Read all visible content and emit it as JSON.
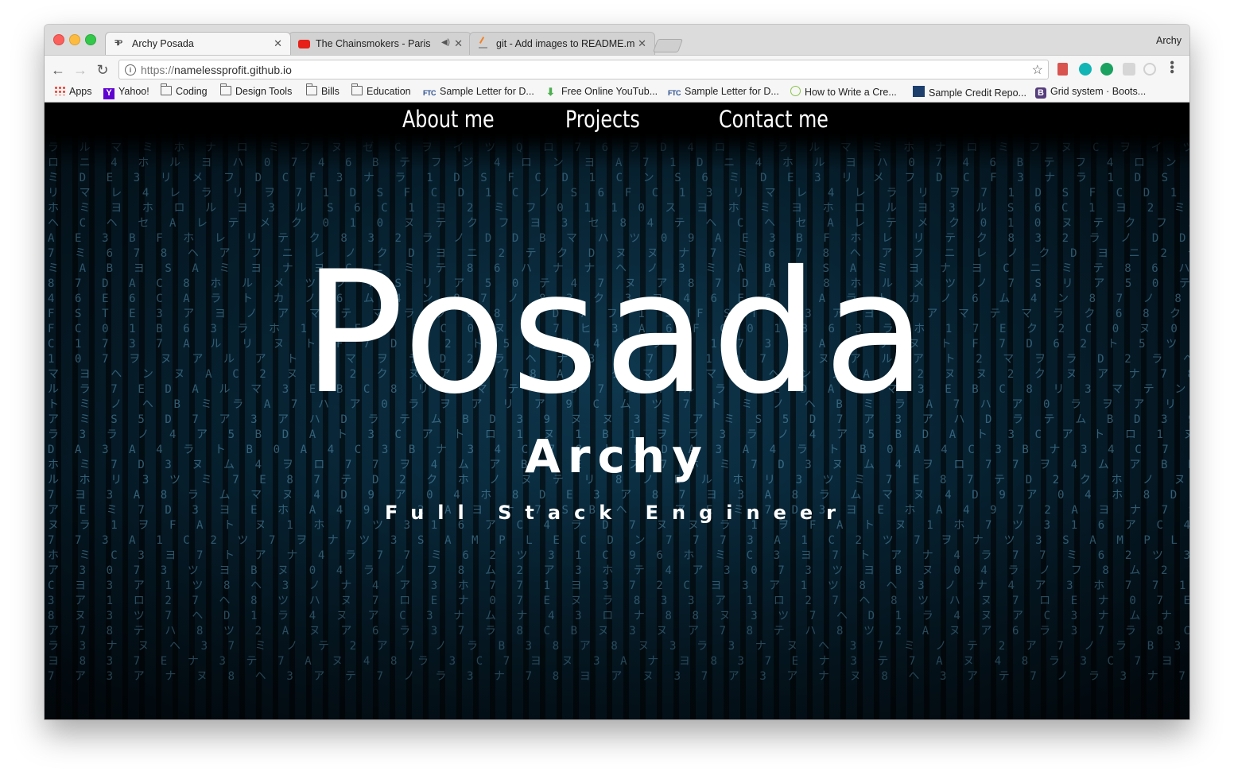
{
  "browser": {
    "tabs": [
      {
        "title": "Archy Posada"
      },
      {
        "title": "The Chainsmokers - Paris (L"
      },
      {
        "title": "git - Add images to README.m"
      }
    ],
    "profile_name": "Archy",
    "address": {
      "scheme": "https://",
      "host": "namelessprofit.github.io"
    }
  },
  "bookmarks": [
    {
      "label": "Apps",
      "icon": "apps-grid-icon"
    },
    {
      "label": "Yahoo!",
      "icon": "yahoo-icon"
    },
    {
      "label": "Coding",
      "icon": "folder-icon"
    },
    {
      "label": "Design Tools",
      "icon": "folder-icon"
    },
    {
      "label": "Bills",
      "icon": "folder-icon"
    },
    {
      "label": "Education",
      "icon": "folder-icon"
    },
    {
      "label": "Sample Letter for D...",
      "icon": "ftc-icon",
      "icon_text": "FTC"
    },
    {
      "label": "Free Online YouTub...",
      "icon": "download-arrow-icon"
    },
    {
      "label": "Sample Letter for D...",
      "icon": "ftc-icon",
      "icon_text": "FTC"
    },
    {
      "label": "How to Write a Cre...",
      "icon": "document-icon"
    },
    {
      "label": "Sample Credit Repo...",
      "icon": "myfico-icon"
    },
    {
      "label": "Grid system · Boots...",
      "icon": "bootstrap-icon",
      "icon_text": "B"
    }
  ],
  "site": {
    "nav": [
      {
        "label": "About me"
      },
      {
        "label": "Projects"
      },
      {
        "label": "Contact me"
      }
    ],
    "hero": {
      "last_name": "Posada",
      "first_name": "Archy",
      "role": "Full Stack Engineer"
    }
  },
  "colors": {
    "nav_background": "#000000",
    "hero_text": "#ffffff",
    "matrix_glyph": "#5c9cbd",
    "matrix_background": "#072333"
  }
}
